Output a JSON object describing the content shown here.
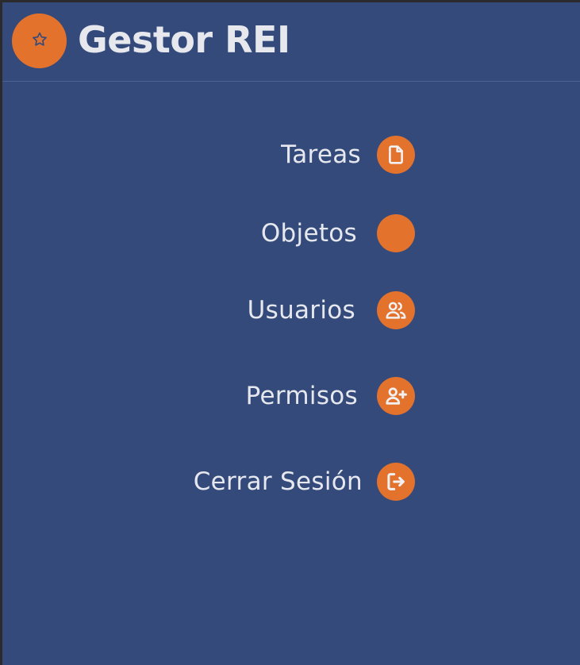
{
  "app": {
    "title": "Gestor REI",
    "logo_icon": "star-icon"
  },
  "colors": {
    "background": "#334a7b",
    "accent": "#e3722d",
    "text": "#e6e8ee"
  },
  "menu": {
    "items": [
      {
        "label": "Tareas",
        "icon": "file-icon"
      },
      {
        "label": "Objetos",
        "icon": "blank-icon"
      },
      {
        "label": "Usuarios",
        "icon": "users-icon"
      },
      {
        "label": "Permisos",
        "icon": "user-plus-icon"
      },
      {
        "label": "Cerrar Sesión",
        "icon": "logout-icon"
      }
    ]
  }
}
